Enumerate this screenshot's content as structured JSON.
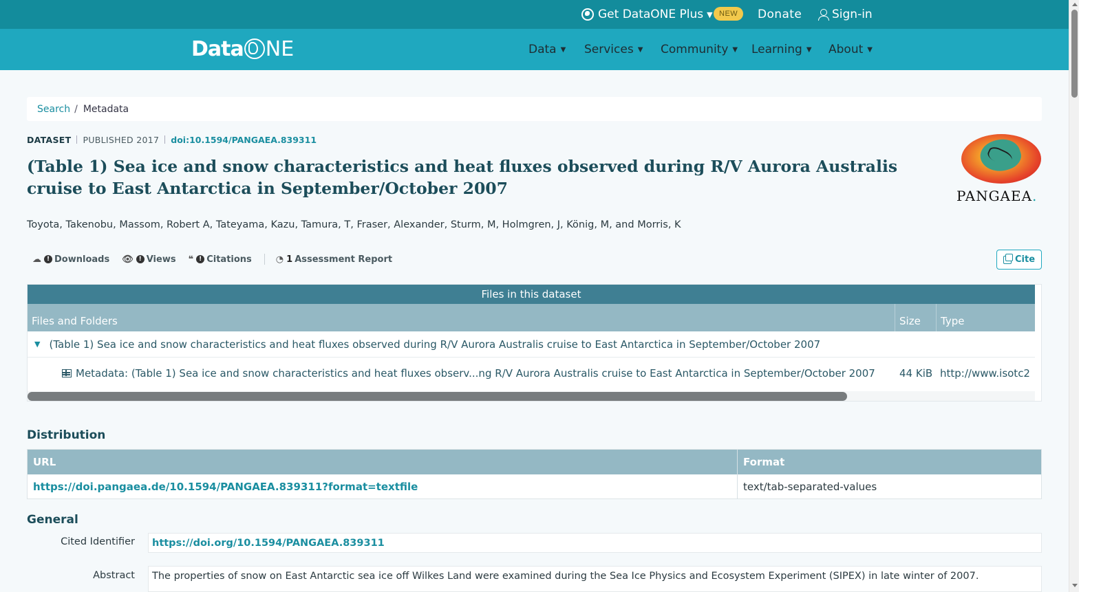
{
  "topbar": {
    "get_plus": "Get DataONE Plus",
    "new_badge": "NEW",
    "donate": "Donate",
    "signin": "Sign-in"
  },
  "navbar": {
    "logo": {
      "data": "Data",
      "one_n": "N",
      "one_e": "E"
    },
    "items": [
      {
        "label": "Data"
      },
      {
        "label": "Services"
      },
      {
        "label": "Community"
      },
      {
        "label": "Learning"
      },
      {
        "label": "About"
      }
    ]
  },
  "breadcrumb": {
    "link": "Search",
    "separator": "/",
    "current": "Metadata"
  },
  "dataset": {
    "type": "DATASET",
    "published": "PUBLISHED 2017",
    "doi": "doi:10.1594/PANGAEA.839311",
    "title": "(Table 1) Sea ice and snow characteristics and heat fluxes observed during R/V Aurora Australis cruise to East Antarctica in September/October 2007",
    "authors": "Toyota, Takenobu, Massom, Robert A, Tateyama, Kazu, Tamura, T, Fraser, Alexander, Sturm, M, Holmgren, J, König, M, and Morris, K",
    "repository_logo_text": "PANGAEA",
    "repository_logo_dot": "."
  },
  "metrics": {
    "downloads": "Downloads",
    "views": "Views",
    "citations": "Citations",
    "assessment_count": "1",
    "assessment": "Assessment Report",
    "cite": "Cite"
  },
  "files": {
    "caption": "Files in this dataset",
    "columns": [
      "Files and Folders",
      "Size",
      "Type"
    ],
    "package_name": "(Table 1) Sea ice and snow characteristics and heat fluxes observed during R/V Aurora Australis cruise to East Antarctica in September/October 2007",
    "rows": [
      {
        "name": "Metadata: (Table 1) Sea ice and snow characteristics and heat fluxes observ...ng R/V Aurora Australis cruise to East Antarctica in September/October 2007",
        "size": "44 KiB",
        "type": "http://www.isotc2"
      }
    ]
  },
  "distribution": {
    "heading": "Distribution",
    "columns": [
      "URL",
      "Format"
    ],
    "url": "https://doi.pangaea.de/10.1594/PANGAEA.839311?format=textfile",
    "format": "text/tab-separated-values"
  },
  "general": {
    "heading": "General",
    "cited_identifier_label": "Cited Identifier",
    "cited_identifier": "https://doi.org/10.1594/PANGAEA.839311",
    "abstract_label": "Abstract",
    "abstract": "The properties of snow on East Antarctic sea ice off Wilkes Land were examined during the Sea Ice Physics and Ecosystem Experiment (SIPEX) in late winter of 2007."
  },
  "colors": {
    "topbar": "#138c9c",
    "navbar": "#1fa8bf",
    "link": "#1a8ea0",
    "title": "#1c4d5a",
    "table_caption": "#3f7f93",
    "table_header": "#94b8c4"
  }
}
